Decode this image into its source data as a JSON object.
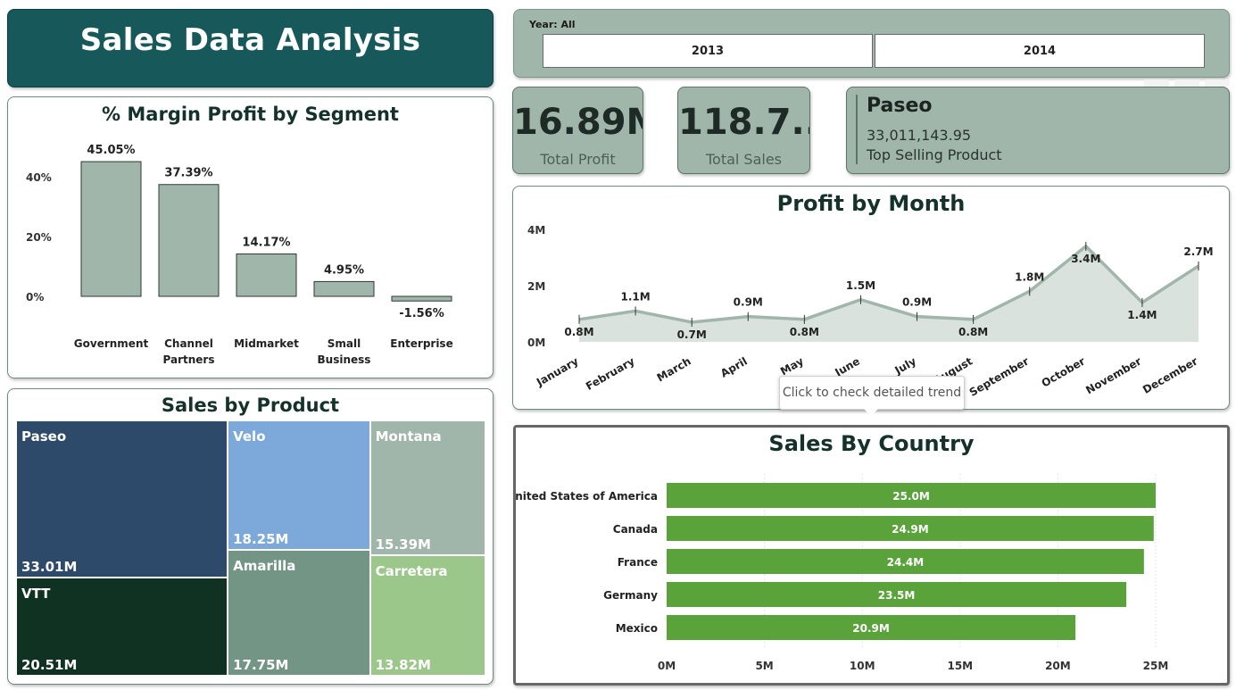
{
  "header": {
    "title": "Sales Data Analysis"
  },
  "slicer": {
    "label": "Year: All",
    "options": [
      "2013",
      "2014"
    ]
  },
  "kpis": [
    {
      "value": "16.89M",
      "label": "Total Profit"
    },
    {
      "value": "118.7...",
      "label": "Total Sales"
    }
  ],
  "top_product": {
    "name": "Paseo",
    "value": "33,011,143.95",
    "label": "Top Selling Product"
  },
  "tooltip": {
    "text": "Click to check detailed trend"
  },
  "colors": {
    "header_bg": "#17595a",
    "card_bg": "#a1b6ab",
    "bar_sage": "#a1b6ab",
    "bar_green": "#5aa33b",
    "area_fill": "#d9e2dd",
    "line": "#a1b6ab"
  },
  "chart_data": [
    {
      "id": "margin",
      "type": "bar",
      "title": "% Margin Profit by Segment",
      "categories": [
        "Government",
        "Channel Partners",
        "Midmarket",
        "Small Business",
        "Enterprise"
      ],
      "category_lines": [
        [
          "Government"
        ],
        [
          "Channel",
          "Partners"
        ],
        [
          "Midmarket"
        ],
        [
          "Small",
          "Business"
        ],
        [
          "Enterprise"
        ]
      ],
      "values": [
        45.05,
        37.39,
        14.17,
        4.95,
        -1.56
      ],
      "data_labels": [
        "45.05%",
        "37.39%",
        "14.17%",
        "4.95%",
        "-1.56%"
      ],
      "yticks": [
        0,
        20,
        40
      ],
      "ytick_labels": [
        "0%",
        "20%",
        "40%"
      ],
      "ylim": [
        -5,
        50
      ],
      "grid": false
    },
    {
      "id": "profit_month",
      "type": "area",
      "title": "Profit by Month",
      "categories": [
        "January",
        "February",
        "March",
        "April",
        "May",
        "June",
        "July",
        "August",
        "September",
        "October",
        "November",
        "December"
      ],
      "values": [
        0.8,
        1.1,
        0.7,
        0.9,
        0.8,
        1.5,
        0.9,
        0.8,
        1.8,
        3.4,
        1.4,
        2.7
      ],
      "data_labels": [
        "0.8M",
        "1.1M",
        "0.7M",
        "0.9M",
        "0.8M",
        "1.5M",
        "0.9M",
        "0.8M",
        "1.8M",
        "3.4M",
        "1.4M",
        "2.7M"
      ],
      "yticks": [
        0,
        2,
        4
      ],
      "ytick_labels": [
        "0M",
        "2M",
        "4M"
      ],
      "ylim": [
        0,
        4
      ],
      "grid": false
    },
    {
      "id": "products",
      "type": "treemap",
      "title": "Sales by Product",
      "items": [
        {
          "name": "Paseo",
          "value": 33.01,
          "label": "33.01M",
          "color": "#2e4a6b"
        },
        {
          "name": "VTT",
          "value": 20.51,
          "label": "20.51M",
          "color": "#0f3222"
        },
        {
          "name": "Velo",
          "value": 18.25,
          "label": "18.25M",
          "color": "#7ca9d9"
        },
        {
          "name": "Amarilla",
          "value": 17.75,
          "label": "17.75M",
          "color": "#729585"
        },
        {
          "name": "Montana",
          "value": 15.39,
          "label": "15.39M",
          "color": "#a1b6ab"
        },
        {
          "name": "Carretera",
          "value": 13.82,
          "label": "13.82M",
          "color": "#9bc78a"
        }
      ]
    },
    {
      "id": "country",
      "type": "bar",
      "orientation": "horizontal",
      "title": "Sales By Country",
      "categories": [
        "United States of America",
        "Canada",
        "France",
        "Germany",
        "Mexico"
      ],
      "values": [
        25.0,
        24.9,
        24.4,
        23.5,
        20.9
      ],
      "data_labels": [
        "25.0M",
        "24.9M",
        "24.4M",
        "23.5M",
        "20.9M"
      ],
      "xticks": [
        0,
        5,
        10,
        15,
        20,
        25
      ],
      "xtick_labels": [
        "0M",
        "5M",
        "10M",
        "15M",
        "20M",
        "25M"
      ],
      "xlim": [
        0,
        25
      ],
      "grid": true
    }
  ]
}
